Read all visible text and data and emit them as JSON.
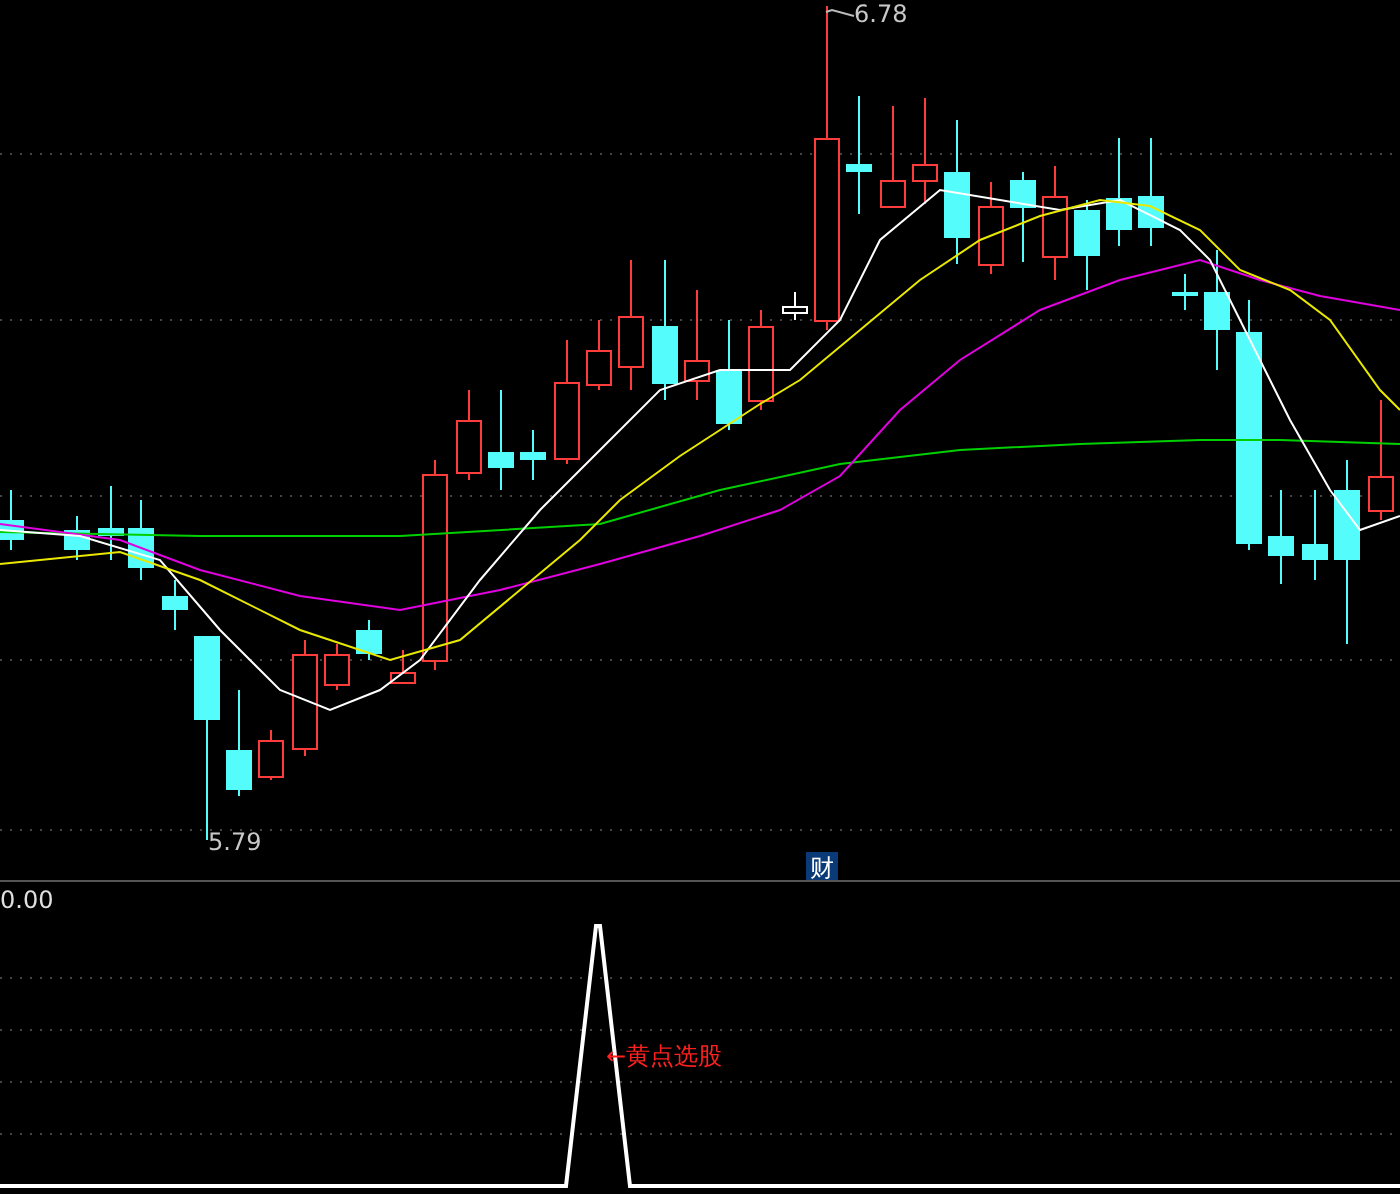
{
  "price_panel": {
    "high_label": "6.78",
    "low_label": "5.79",
    "badge": "财"
  },
  "indicator_panel": {
    "axis_label": "0.00",
    "signal_label": "←黄点选股"
  }
}
